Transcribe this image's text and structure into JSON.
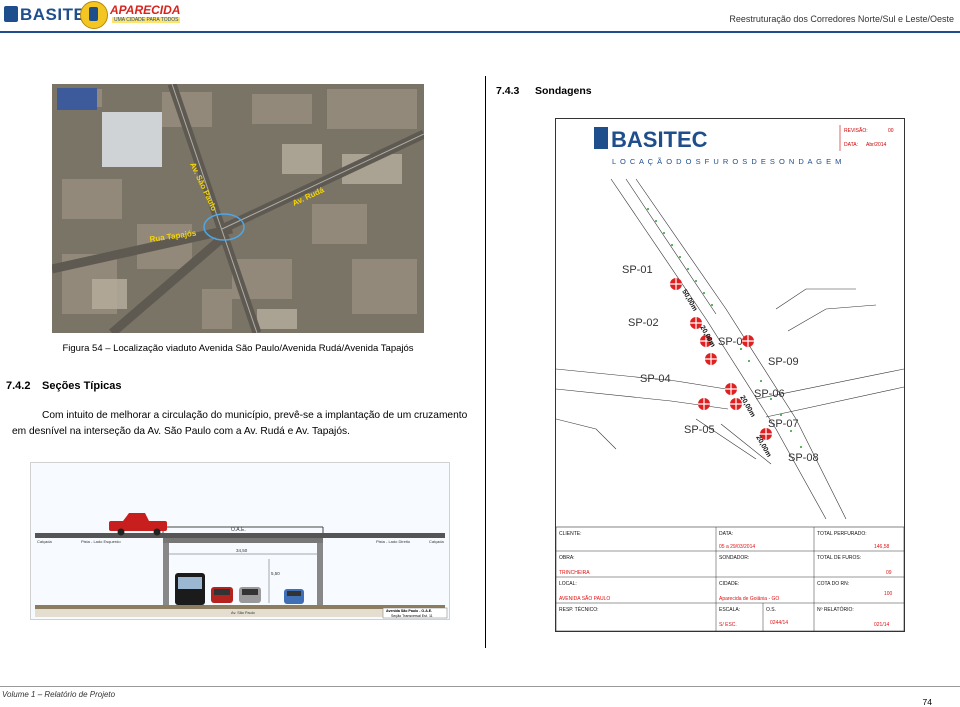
{
  "header": {
    "logo_basitec": "BASITEC",
    "logo_aparecida": "APARECIDA",
    "logo_aparecida_sub": "UMA CIDADE PARA TODOS",
    "title": "Reestruturação dos Corredores Norte/Sul e Leste/Oeste"
  },
  "left": {
    "map_labels": [
      "Av. São Paulo",
      "Av. Rudá",
      "Rua Tapajós"
    ],
    "figure_caption": "Figura 54 – Localização viaduto Avenida São Paulo/Avenida Rudá/Avenida Tapajós",
    "section_number": "7.4.2",
    "section_title": "Seções Típicas",
    "paragraph": "Com intuito de melhorar a circulação do município, prevê-se a implantação de um cruzamento em desnível na interseção da Av. São Paulo com a Av. Rudá e Av. Tapajós.",
    "drawing": {
      "top_label": "O.A.E.",
      "left_label": "Pista - Lado Esquerdo",
      "right_label": "Pista - Lado Direito",
      "edge_left": "Calçada",
      "edge_right": "Calçada",
      "width_label": "34,50",
      "height_label": "5,50",
      "bottom_label": "Av. São Paulo",
      "stamp_line1": "Avenida São Paulo - O.A.E.",
      "stamp_line2": "Seção Transversal Est. 11"
    }
  },
  "right": {
    "section_number": "7.4.3",
    "section_title": "Sondagens",
    "sheet": {
      "logo": "BASITEC",
      "revisao_label": "REVISÃO:",
      "revisao_value": "00",
      "data_label": "DATA:",
      "data_value": "Abr/2014",
      "title": "L O C A Ç Ã O   D O S   F U R O S   D E   S O N D A G E M",
      "points": [
        "SP-01",
        "SP-02",
        "SP-03",
        "SP-04",
        "SP-05",
        "SP-06",
        "SP-07",
        "SP-08",
        "SP-09"
      ],
      "distances": [
        "50,00m",
        "20,00m",
        "20,00m",
        "20,00m"
      ],
      "table": {
        "cliente_label": "CLIENTE:",
        "data_label": "DATA:",
        "data_value": "05 a 29/03/2014",
        "total_perf_label": "TOTAL PERFURADO:",
        "total_perf_value": "146,58",
        "obra_label": "OBRA:",
        "sondador_label": "SONDADOR:",
        "total_furos_label": "TOTAL DE FUROS:",
        "total_furos_value": "09",
        "obra_value": "TRINCHEIRA",
        "local_label": "LOCAL:",
        "cidade_label": "CIDADE:",
        "cota_label": "COTA DO RN:",
        "cota_value": "100",
        "local_value": "AVENIDA SÃO PAULO",
        "cidade_value": "Aparecida de Goiânia - GO",
        "resp_label": "RESP. TÉCNICO:",
        "escala_label": "ESCALA:",
        "os_label": "O.S.",
        "relatorio_label": "Nº RELATÓRIO:",
        "resp_value": "S/ ESC.",
        "os_value": "0244/14",
        "relatorio_value": "021/14"
      }
    }
  },
  "footer": {
    "left": "Volume 1 – Relatório de Projeto",
    "page": "74"
  },
  "colors": {
    "brand_blue": "#1f4e8c",
    "drill_red": "#e02020",
    "map_label": "#f5d400"
  }
}
